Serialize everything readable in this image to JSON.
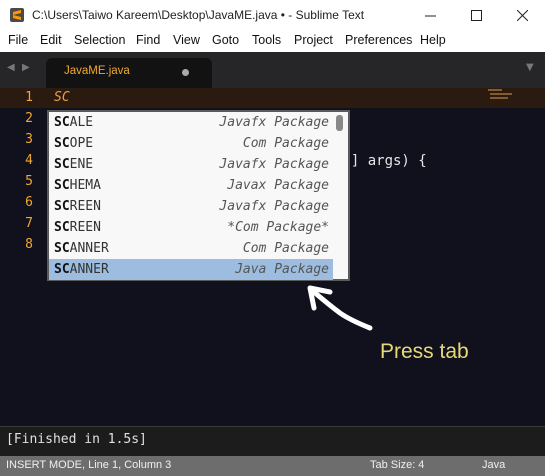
{
  "window": {
    "title": "C:\\Users\\Taiwo Kareem\\Desktop\\JavaME.java • - Sublime Text",
    "buttons": {
      "minimize": "—",
      "maximize": "☐",
      "close": "✕"
    }
  },
  "menu": [
    "File",
    "Edit",
    "Selection",
    "Find",
    "View",
    "Goto",
    "Tools",
    "Project",
    "Preferences",
    "Help"
  ],
  "tabs": {
    "nav_left": "◀",
    "nav_right": "▶",
    "active": "JavaME.java",
    "overflow": "▼"
  },
  "editor": {
    "line_numbers": [
      "1",
      "2",
      "3",
      "4",
      "5",
      "6",
      "7",
      "8"
    ],
    "line1_text": "SC",
    "visible_code": "g[] args) {"
  },
  "autocomplete": {
    "items": [
      {
        "prefix": "SC",
        "rest": "ALE",
        "type": "Javafx Package"
      },
      {
        "prefix": "SC",
        "rest": "OPE",
        "type": "Com Package"
      },
      {
        "prefix": "SC",
        "rest": "ENE",
        "type": "Javafx Package"
      },
      {
        "prefix": "SC",
        "rest": "HEMA",
        "type": "Javax Package"
      },
      {
        "prefix": "SC",
        "rest": "REEN",
        "type": "Javafx Package"
      },
      {
        "prefix": "SC",
        "rest": "REEN",
        "type": "*Com Package*"
      },
      {
        "prefix": "SC",
        "rest": "ANNER",
        "type": "Com Package"
      },
      {
        "prefix": "SC",
        "rest": "ANNER",
        "type": "Java Package"
      }
    ],
    "selected_index": 7
  },
  "annotation": {
    "text": "Press tab"
  },
  "output": {
    "text": "[Finished in 1.5s]"
  },
  "status": {
    "mode": "INSERT MODE, Line 1, Column 3",
    "tab_size": "Tab Size: 4",
    "syntax": "Java"
  },
  "colors": {
    "accent": "#f0a830",
    "editor_bg": "#11111d",
    "selection": "#9cbde0",
    "annotation": "#e8d878"
  }
}
